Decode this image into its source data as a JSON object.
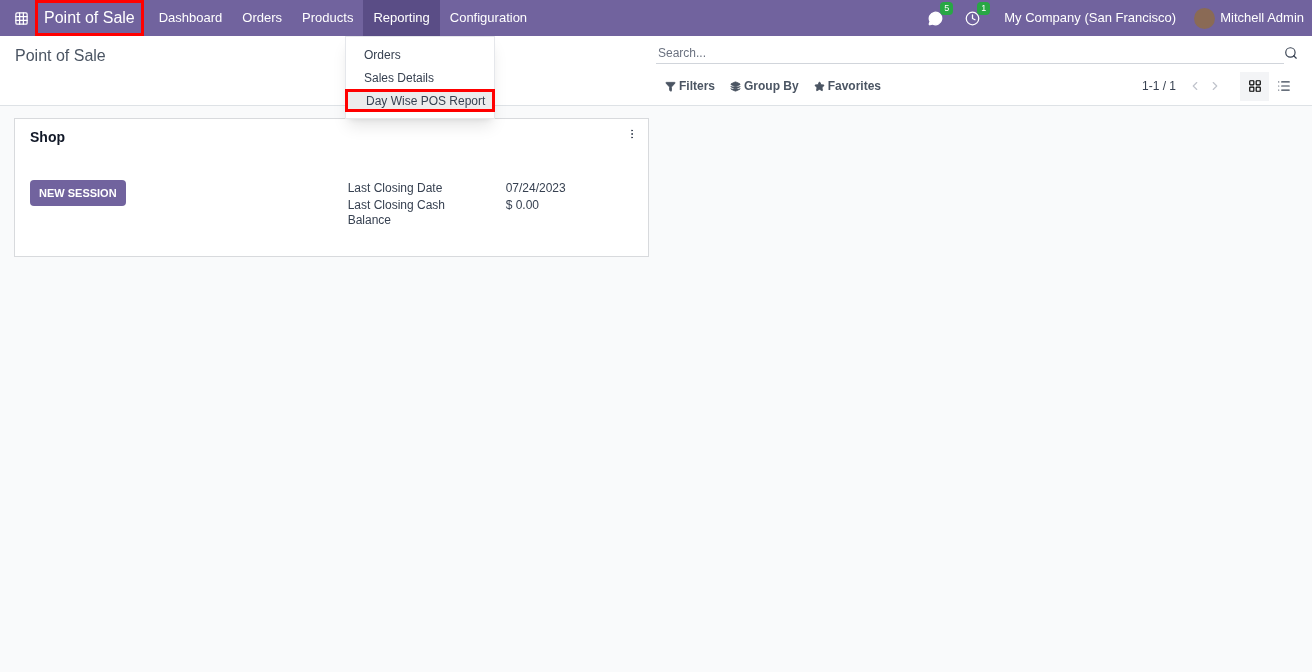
{
  "navbar": {
    "app_name": {
      "label": "Point of Sale",
      "highlighted": true
    },
    "menu": [
      {
        "label": "Dashboard",
        "selected": false
      },
      {
        "label": "Orders",
        "selected": false
      },
      {
        "label": "Products",
        "selected": false
      },
      {
        "label": "Reporting",
        "selected": true
      },
      {
        "label": "Configuration",
        "selected": false
      }
    ],
    "messages_count": "5",
    "activities_count": "1",
    "company": "My Company (San Francisco)",
    "user": "Mitchell Admin"
  },
  "dropdown": {
    "items": [
      {
        "label": "Orders",
        "highlighted": false
      },
      {
        "label": "Sales Details",
        "highlighted": false
      },
      {
        "label": "Day Wise POS Report",
        "highlighted": true
      }
    ]
  },
  "breadcrumb": "Point of Sale",
  "search": {
    "placeholder": "Search..."
  },
  "filters": [
    {
      "label": "Filters",
      "kind": "filter"
    },
    {
      "label": "Group By",
      "kind": "group"
    },
    {
      "label": "Favorites",
      "kind": "star"
    }
  ],
  "pager": "1-1 / 1",
  "views": [
    {
      "kind": "kanban",
      "selected": true
    },
    {
      "kind": "list",
      "selected": false
    }
  ],
  "cards": [
    {
      "title": "Shop",
      "button": "NEW SESSION",
      "fields": [
        {
          "label": "Last Closing Date",
          "value": "07/24/2023"
        },
        {
          "label": "Last Closing Cash Balance",
          "value": "$ 0.00"
        }
      ]
    }
  ]
}
